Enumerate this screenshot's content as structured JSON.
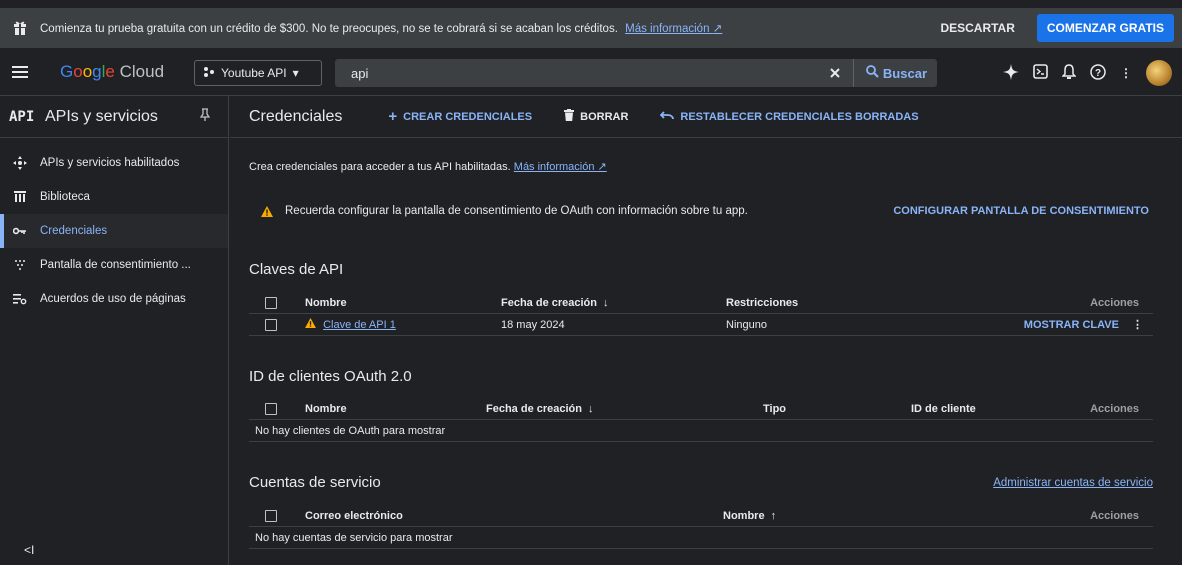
{
  "promo": {
    "message": "Comienza tu prueba gratuita con un crédito de $300. No te preocupes, no se te cobrará si se acaban los créditos.",
    "link": "Más información",
    "dismiss": "DESCARTAR",
    "start": "COMENZAR GRATIS"
  },
  "appbar": {
    "logo_google": [
      "G",
      "o",
      "o",
      "g",
      "l",
      "e"
    ],
    "logo_cloud": "Cloud",
    "project": "Youtube API",
    "search_value": "api",
    "search_button": "Buscar"
  },
  "sidebar": {
    "api_icon": "API",
    "title": "APIs y servicios",
    "items": [
      {
        "label": "APIs y servicios habilitados",
        "icon": "enabled-apis-icon"
      },
      {
        "label": "Biblioteca",
        "icon": "library-icon"
      },
      {
        "label": "Credenciales",
        "icon": "key-icon"
      },
      {
        "label": "Pantalla de consentimiento ...",
        "icon": "consent-icon"
      },
      {
        "label": "Acuerdos de uso de páginas",
        "icon": "agreements-icon"
      }
    ],
    "collapse": "<I"
  },
  "main": {
    "title": "Credenciales",
    "actions": {
      "create": "CREAR CREDENCIALES",
      "delete": "BORRAR",
      "restore": "RESTABLECER CREDENCIALES BORRADAS"
    },
    "intro": "Crea credenciales para acceder a tus API habilitadas.",
    "intro_link": "Más información",
    "alert_text": "Recuerda configurar la pantalla de consentimiento de OAuth con información sobre tu app.",
    "alert_button": "CONFIGURAR PANTALLA DE CONSENTIMIENTO"
  },
  "api_keys": {
    "title": "Claves de API",
    "headers": {
      "name": "Nombre",
      "created": "Fecha de creación",
      "restrictions": "Restricciones",
      "actions": "Acciones"
    },
    "rows": [
      {
        "name": "Clave de API 1",
        "created": "18 may 2024",
        "restrictions": "Ninguno",
        "action": "MOSTRAR CLAVE"
      }
    ]
  },
  "oauth": {
    "title": "ID de clientes OAuth 2.0",
    "headers": {
      "name": "Nombre",
      "created": "Fecha de creación",
      "type": "Tipo",
      "client_id": "ID de cliente",
      "actions": "Acciones"
    },
    "empty": "No hay clientes de OAuth para mostrar"
  },
  "service_accounts": {
    "title": "Cuentas de servicio",
    "manage_link": "Administrar cuentas de servicio",
    "headers": {
      "email": "Correo electrónico",
      "name": "Nombre",
      "actions": "Acciones"
    },
    "empty": "No hay cuentas de servicio para mostrar"
  },
  "colors": {
    "accent": "#8ab4f8",
    "primary": "#1a73e8",
    "warning": "#f9ab00",
    "background": "#202124"
  }
}
